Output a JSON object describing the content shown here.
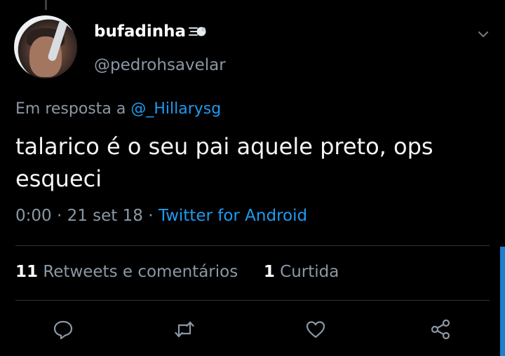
{
  "tweet": {
    "author_name": "bufadinha",
    "author_handle": "@pedrohsavelar",
    "reply_prefix": "Em resposta a",
    "reply_mention": "@_Hillarysg",
    "text": "talarico é o seu pai aquele preto, ops esqueci",
    "time": "0:00",
    "date": "21 set 18",
    "separator": "·",
    "source": "Twitter for Android",
    "retweets_count": "11",
    "retweets_label": "Retweets e comentários",
    "likes_count": "1",
    "likes_label": "Curtida"
  },
  "icons": {
    "name_emoji": "dashing-away-icon",
    "menu": "chevron-down-icon",
    "reply": "reply-icon",
    "retweet": "retweet-icon",
    "like": "heart-icon",
    "share": "share-icon"
  },
  "colors": {
    "background": "#000000",
    "text_primary": "#ffffff",
    "text_secondary": "#8b98a5",
    "link": "#1d9bf0",
    "divider": "#2f3336",
    "scrollbar": "#1d7fd0"
  }
}
